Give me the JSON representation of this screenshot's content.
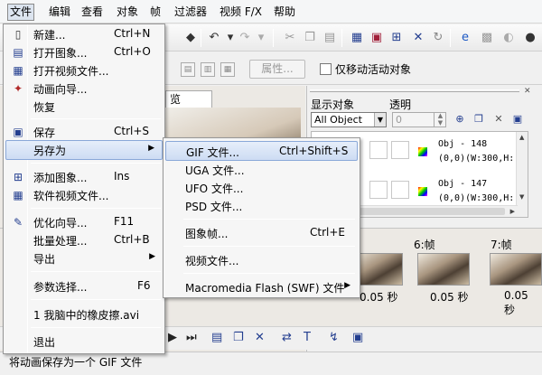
{
  "menubar": {
    "items": [
      {
        "label": "文件"
      },
      {
        "label": "编辑"
      },
      {
        "label": "查看"
      },
      {
        "label": "对象"
      },
      {
        "label": "帧"
      },
      {
        "label": "过滤器"
      },
      {
        "label": "视频 F/X"
      },
      {
        "label": "帮助"
      }
    ]
  },
  "toolbar2": {
    "properties_label": "属性...",
    "move_active_label": "仅移动活动对象"
  },
  "preview": {
    "tab_label": "览"
  },
  "right_panel": {
    "show_objects_label": "显示对象",
    "transparency_label": "透明",
    "objects_select_value": "All Object",
    "transparency_value": "0",
    "objects": [
      {
        "line1": "Obj - 148",
        "line2": "(0,0)(W:300,H:"
      },
      {
        "line1": "Obj - 147",
        "line2": "(0,0)(W:300,H:"
      }
    ]
  },
  "frames": {
    "labels": [
      "6:帧",
      "7:帧"
    ],
    "times": [
      "0.05 秒",
      "0.05 秒",
      "0.05 秒"
    ]
  },
  "file_menu": {
    "items": [
      {
        "label": "新建...",
        "shortcut": "Ctrl+N",
        "icon": "new-file-icon"
      },
      {
        "label": "打开图象...",
        "shortcut": "Ctrl+O",
        "icon": "open-image-icon"
      },
      {
        "label": "打开视频文件...",
        "shortcut": "",
        "icon": "open-video-icon"
      },
      {
        "label": "动画向导...",
        "shortcut": "",
        "icon": "wizard-icon"
      },
      {
        "label": "恢复",
        "shortcut": "",
        "icon": ""
      },
      {
        "label": "保存",
        "shortcut": "Ctrl+S",
        "icon": "save-icon"
      },
      {
        "label": "另存为",
        "shortcut": "",
        "icon": ""
      },
      {
        "label": "添加图象...",
        "shortcut": "Ins",
        "icon": "add-image-icon"
      },
      {
        "label": "软件视频文件...",
        "shortcut": "",
        "icon": "add-video-icon"
      },
      {
        "label": "优化向导...",
        "shortcut": "F11",
        "icon": "optimize-icon"
      },
      {
        "label": "批量处理...",
        "shortcut": "Ctrl+B",
        "icon": ""
      },
      {
        "label": "导出",
        "shortcut": "",
        "icon": ""
      },
      {
        "label": "参数选择...",
        "shortcut": "F6",
        "icon": ""
      },
      {
        "label": "1 我脑中的橡皮擦.avi",
        "shortcut": "",
        "icon": ""
      },
      {
        "label": "退出",
        "shortcut": "",
        "icon": ""
      }
    ]
  },
  "saveas_menu": {
    "items": [
      {
        "label": "GIF 文件...",
        "shortcut": "Ctrl+Shift+S"
      },
      {
        "label": "UGA 文件...",
        "shortcut": ""
      },
      {
        "label": "UFO 文件...",
        "shortcut": ""
      },
      {
        "label": "PSD 文件...",
        "shortcut": ""
      },
      {
        "label": "图象帧...",
        "shortcut": "Ctrl+E"
      },
      {
        "label": "视频文件...",
        "shortcut": ""
      },
      {
        "label": "Macromedia Flash (SWF) 文件",
        "shortcut": ""
      }
    ]
  },
  "statusbar": {
    "text": "将动画保存为一个 GIF 文件"
  }
}
